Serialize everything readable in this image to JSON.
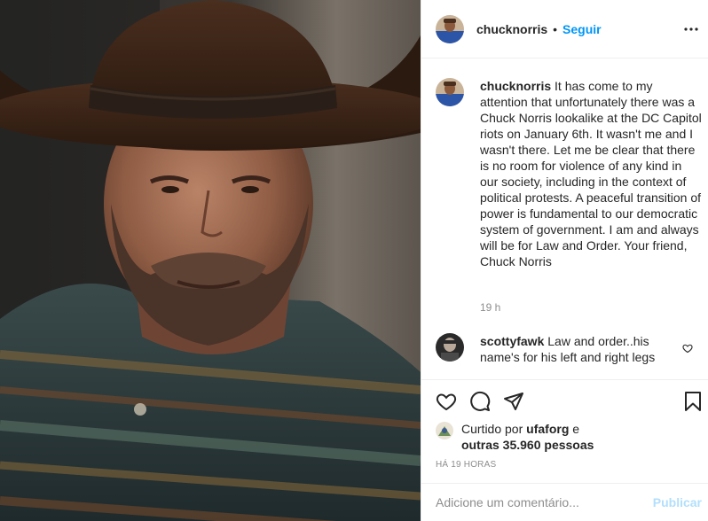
{
  "post": {
    "username": "chucknorris",
    "separator": "•",
    "follow_label": "Seguir",
    "more_icon": "more-horizontal-icon",
    "caption_username": "chucknorris",
    "caption_text": "It has come to my attention that unfortunately there was a Chuck Norris lookalike at the DC Capitol riots on January 6th. It wasn't me and I wasn't there. Let me be clear that there is no room for violence of any kind in our society, including in the context of political protests. A peaceful transition of power is fundamental to our democratic system of government. I am and always will be for Law and Order. Your friend, Chuck Norris",
    "caption_time": "19 h"
  },
  "comment": {
    "username": "scottyfawk",
    "text": "Law and order..his name's for his left and right legs",
    "like_icon": "heart-outline-icon"
  },
  "actions": {
    "icons": [
      "heart-icon",
      "comment-icon",
      "share-icon",
      "bookmark-icon"
    ],
    "liked_by_prefix": "Curtido por",
    "liked_by_user": "ufaforg",
    "liked_by_joiner": "e",
    "liked_by_others": "outras 35.960 pessoas",
    "time_ago": "HÁ 19 HORAS"
  },
  "add_comment": {
    "placeholder": "Adicione um comentário...",
    "post_label": "Publicar"
  },
  "colors": {
    "accent": "#0095f6",
    "post_disabled": "#b2dffc",
    "muted": "#8e8e8e",
    "text": "#262626"
  }
}
